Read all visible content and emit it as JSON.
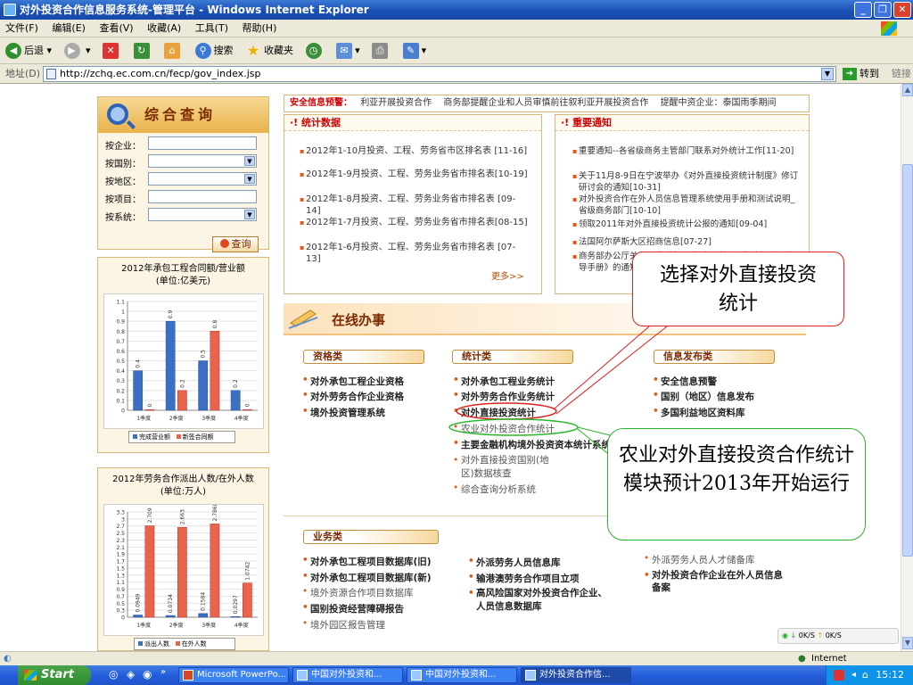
{
  "window": {
    "title": "对外投资合作信息服务系统-管理平台 - Windows Internet Explorer"
  },
  "menu": [
    "文件(F)",
    "编辑(E)",
    "查看(V)",
    "收藏(A)",
    "工具(T)",
    "帮助(H)"
  ],
  "toolbar": {
    "back": "后退",
    "search": "搜索",
    "favorites": "收藏夹"
  },
  "address": {
    "label": "地址(D)",
    "url": "http://zchq.ec.com.cn/fecp/gov_index.jsp",
    "go": "转到",
    "links": "链接"
  },
  "query": {
    "title": "综合查询",
    "fields": [
      {
        "label": "按企业：",
        "type": "input"
      },
      {
        "label": "按国别：",
        "type": "select"
      },
      {
        "label": "按地区：",
        "type": "select"
      },
      {
        "label": "按项目：",
        "type": "input"
      },
      {
        "label": "按系统：",
        "type": "select"
      }
    ],
    "button": "查询"
  },
  "alert": {
    "label": "安全信息预警：",
    "scroll": [
      "利亚开展投资合作",
      "商务部提醒企业和人员审慎前往叙利亚开展投资合作",
      "提醒中资企业：泰国雨季期间"
    ]
  },
  "stats": {
    "title": "统计数据",
    "items": [
      "2012年1-10月投资、工程、劳务省市区排名表 [11-16]",
      "2012年1-9月投资、工程、劳务业务省市排名表[10-19]",
      "2012年1-8月投资、工程、劳务业务省市排名表 [09-14]",
      "2012年1-7月投资、工程、劳务业务省市排名表[08-15]",
      "2012年1-6月投资、工程、劳务业务省市排名表 [07-13]"
    ],
    "more": "更多>>"
  },
  "notices": {
    "title": "重要通知",
    "items": [
      "重要通知--各省级商务主管部门联系对外统计工作[11-20]",
      "关于11月8-9日在宁波举办《对外直接投资统计制度》修订研讨会的通知[10-31]",
      "对外投资合作在外人员信息管理系统使用手册和测试说明_省级商务部门[10-10]",
      "领取2011年对外直接投资统计公报的通知[09-04]",
      "法国阿尔萨斯大区招商信息[07-27]",
      "商务部办公厅关于印发《〈国别投资经营障碍报告〉编写指导手册》的通知[07-"
    ]
  },
  "online": {
    "title": "在线办事",
    "categories": {
      "qual": "资格类",
      "stat": "统计类",
      "info": "信息发布类",
      "biz": "业务类"
    },
    "qual_links": [
      "对外承包工程企业资格",
      "对外劳务合作企业资格",
      "境外投资管理系统"
    ],
    "stat_links": [
      "对外承包工程业务统计",
      "对外劳务合作业务统计",
      "对外直接投资统计",
      "农业对外投资合作统计",
      "主要金融机构境外投资资本统计系统",
      "对外直接投资国别(地区)数据核查",
      "综合查询分析系统"
    ],
    "info_links": [
      "安全信息预警",
      "国别（地区）信息发布",
      "多国利益地区资料库"
    ],
    "biz_col1": [
      "对外承包工程项目数据库(旧)",
      "对外承包工程项目数据库(新)",
      "境外资源合作项目数据库",
      "国别投资经营障碍报告",
      "境外园区报告管理"
    ],
    "biz_col2": [
      "外派劳务人员信息库",
      "输港澳劳务合作项目立项",
      "高风险国家对外投资合作企业、人员信息数据库"
    ],
    "biz_col3": [
      "外派劳务人员人才储备库",
      "对外投资合作企业在外人员信息备案"
    ]
  },
  "callouts": {
    "top": "选择对外直接投资统计",
    "bottom": "农业对外直接投资合作统计模块预计2013年开始运行"
  },
  "chart_data": [
    {
      "type": "bar",
      "title": "2012年承包工程合同额/营业额",
      "subtitle": "(单位:亿美元)",
      "categories": [
        "1季度",
        "2季度",
        "3季度",
        "4季度"
      ],
      "ylim": [
        0,
        1.1
      ],
      "yticks": [
        "0",
        "0.1",
        "0.2",
        "0.3",
        "0.4",
        "0.5",
        "0.6",
        "0.7",
        "0.8",
        "0.9",
        "1",
        "1.1"
      ],
      "series": [
        {
          "name": "完成营业额",
          "color": "#3a6fc4",
          "values": [
            0.4,
            0.9,
            0.5,
            0.2
          ]
        },
        {
          "name": "新签合同额",
          "color": "#e8644a",
          "values": [
            0,
            0.2,
            0.8,
            0
          ]
        }
      ],
      "labels": [
        [
          "0.4",
          "0.9",
          "0.5",
          "0.2"
        ],
        [
          "0",
          "0.2",
          "0.8",
          "0"
        ]
      ]
    },
    {
      "type": "bar",
      "title": "2012年劳务合作派出人数/在外人数",
      "subtitle": "(单位:万人)",
      "categories": [
        "1季度",
        "2季度",
        "3季度",
        "4季度"
      ],
      "ylim": [
        0,
        3.3
      ],
      "yticks": [
        "0",
        "0.3",
        "0.5",
        "0.7",
        "0.9",
        "1.1",
        "1.3",
        "1.5",
        "1.7",
        "1.9",
        "2.1",
        "2.3",
        "2.5",
        "2.7",
        "3",
        "3.3"
      ],
      "series": [
        {
          "name": "派出人数",
          "color": "#3a6fc4",
          "values": [
            0.0949,
            0.0734,
            0.1584,
            0.0297
          ]
        },
        {
          "name": "在外人数",
          "color": "#e8644a",
          "values": [
            2.709,
            2.663,
            2.7868,
            1.0742
          ]
        }
      ],
      "labels": [
        [
          "0.0949",
          "0.0734",
          "0.1584",
          "0.0297"
        ],
        [
          "2.709",
          "2.663",
          "2.7868",
          "1.0742"
        ]
      ]
    }
  ],
  "status": {
    "zone": "Internet",
    "down": "0K/S",
    "up": "0K/S"
  },
  "taskbar": {
    "start": "Start",
    "tasks": [
      "Microsoft PowerPo...",
      "中国对外投资和...",
      "中国对外投资和...",
      "对外投资合作信..."
    ],
    "time": "15:12"
  }
}
